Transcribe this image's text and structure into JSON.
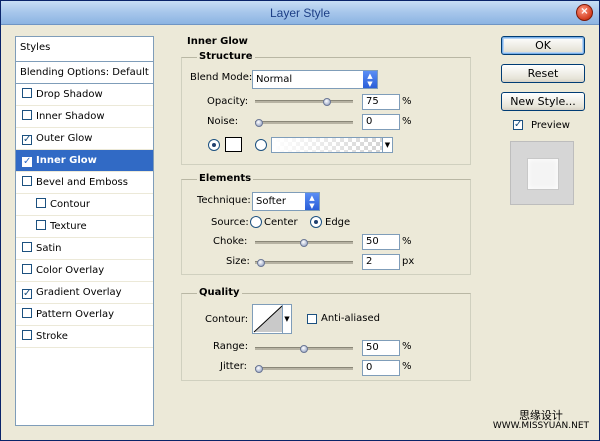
{
  "window": {
    "title": "Layer Style",
    "close": "×"
  },
  "styles_panel": {
    "header": "Styles",
    "items": [
      {
        "label": "Blending Options: Default",
        "checkbox": false,
        "checked": false,
        "sub": false,
        "selected": false,
        "first": true
      },
      {
        "label": "Drop Shadow",
        "checkbox": true,
        "checked": false,
        "sub": false,
        "selected": false
      },
      {
        "label": "Inner Shadow",
        "checkbox": true,
        "checked": false,
        "sub": false,
        "selected": false
      },
      {
        "label": "Outer Glow",
        "checkbox": true,
        "checked": true,
        "sub": false,
        "selected": false
      },
      {
        "label": "Inner Glow",
        "checkbox": true,
        "checked": true,
        "sub": false,
        "selected": true
      },
      {
        "label": "Bevel and Emboss",
        "checkbox": true,
        "checked": false,
        "sub": false,
        "selected": false
      },
      {
        "label": "Contour",
        "checkbox": true,
        "checked": false,
        "sub": true,
        "selected": false
      },
      {
        "label": "Texture",
        "checkbox": true,
        "checked": false,
        "sub": true,
        "selected": false
      },
      {
        "label": "Satin",
        "checkbox": true,
        "checked": false,
        "sub": false,
        "selected": false
      },
      {
        "label": "Color Overlay",
        "checkbox": true,
        "checked": false,
        "sub": false,
        "selected": false
      },
      {
        "label": "Gradient Overlay",
        "checkbox": true,
        "checked": true,
        "sub": false,
        "selected": false
      },
      {
        "label": "Pattern Overlay",
        "checkbox": true,
        "checked": false,
        "sub": false,
        "selected": false
      },
      {
        "label": "Stroke",
        "checkbox": true,
        "checked": false,
        "sub": false,
        "selected": false
      }
    ]
  },
  "inner_glow": {
    "section_title": "Inner Glow",
    "structure": {
      "title": "Structure",
      "blend_mode_label": "Blend Mode:",
      "blend_mode_value": "Normal",
      "opacity_label": "Opacity:",
      "opacity_value": "75",
      "opacity_level": 0.75,
      "opacity_unit": "%",
      "noise_label": "Noise:",
      "noise_value": "0",
      "noise_level": 0,
      "noise_unit": "%",
      "glow_color": "#ffffff"
    },
    "elements": {
      "title": "Elements",
      "technique_label": "Technique:",
      "technique_value": "Softer",
      "source_label": "Source:",
      "source_center": "Center",
      "source_edge": "Edge",
      "choke_label": "Choke:",
      "choke_value": "50",
      "choke_level": 0.5,
      "choke_unit": "%",
      "size_label": "Size:",
      "size_value": "2",
      "size_level": 0.02,
      "size_unit": "px"
    },
    "quality": {
      "title": "Quality",
      "contour_label": "Contour:",
      "anti_aliased_label": "Anti-aliased",
      "range_label": "Range:",
      "range_value": "50",
      "range_level": 0.5,
      "range_unit": "%",
      "jitter_label": "Jitter:",
      "jitter_value": "0",
      "jitter_level": 0,
      "jitter_unit": "%"
    }
  },
  "buttons": {
    "ok": "OK",
    "reset": "Reset",
    "new_style": "New Style...",
    "preview_label": "Preview"
  },
  "watermark": {
    "cn": "思缘设计",
    "en": "WWW.MISSYUAN.NET"
  }
}
